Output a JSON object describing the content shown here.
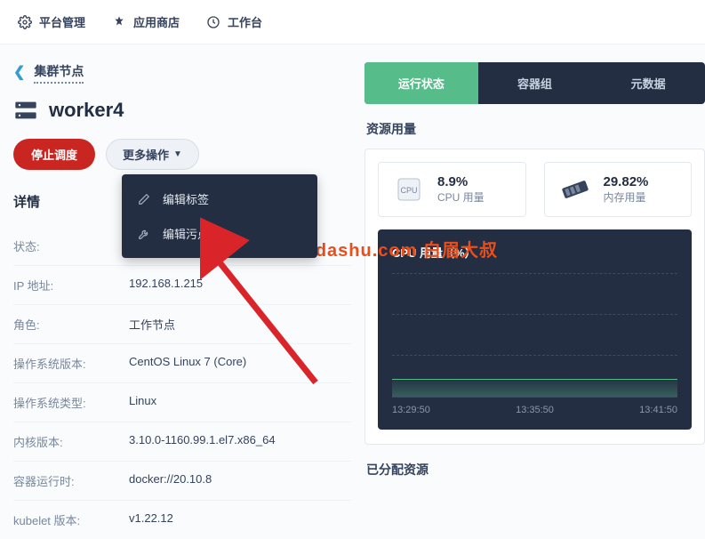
{
  "topbar": {
    "platform": "平台管理",
    "appstore": "应用商店",
    "workbench": "工作台"
  },
  "breadcrumb": {
    "back_label": "集群节点"
  },
  "node": {
    "name": "worker4"
  },
  "actions": {
    "stop_schedule": "停止调度",
    "more_ops": "更多操作"
  },
  "dropdown": {
    "edit_labels": "编辑标签",
    "edit_taints": "编辑污点"
  },
  "details": {
    "title": "详情",
    "rows": [
      {
        "label": "状态:",
        "value": ""
      },
      {
        "label": "IP 地址:",
        "value": "192.168.1.215"
      },
      {
        "label": "角色:",
        "value": "工作节点"
      },
      {
        "label": "操作系统版本:",
        "value": "CentOS Linux 7 (Core)"
      },
      {
        "label": "操作系统类型:",
        "value": "Linux"
      },
      {
        "label": "内核版本:",
        "value": "3.10.0-1160.99.1.el7.x86_64"
      },
      {
        "label": "容器运行时:",
        "value": "docker://20.10.8"
      },
      {
        "label": "kubelet 版本:",
        "value": "v1.22.12"
      }
    ]
  },
  "tabs": {
    "running": "运行状态",
    "pods": "容器组",
    "metadata": "元数据"
  },
  "resource": {
    "title": "资源用量",
    "cpu_pct": "8.9%",
    "cpu_label": "CPU 用量",
    "cpu_badge": "CPU",
    "mem_pct": "29.82%",
    "mem_label": "内存用量"
  },
  "chart_data": {
    "type": "area",
    "title": "CPU 用量（%）",
    "ylim": [
      0,
      100
    ],
    "x_ticks": [
      "13:29:50",
      "13:35:50",
      "13:41:50"
    ],
    "series": [
      {
        "name": "CPU",
        "values": [
          9,
          9,
          9,
          9,
          9,
          9,
          9,
          9
        ]
      }
    ]
  },
  "allocated": {
    "title": "已分配资源"
  },
  "watermark": "www.baimeidashu.com 白眉大叔"
}
